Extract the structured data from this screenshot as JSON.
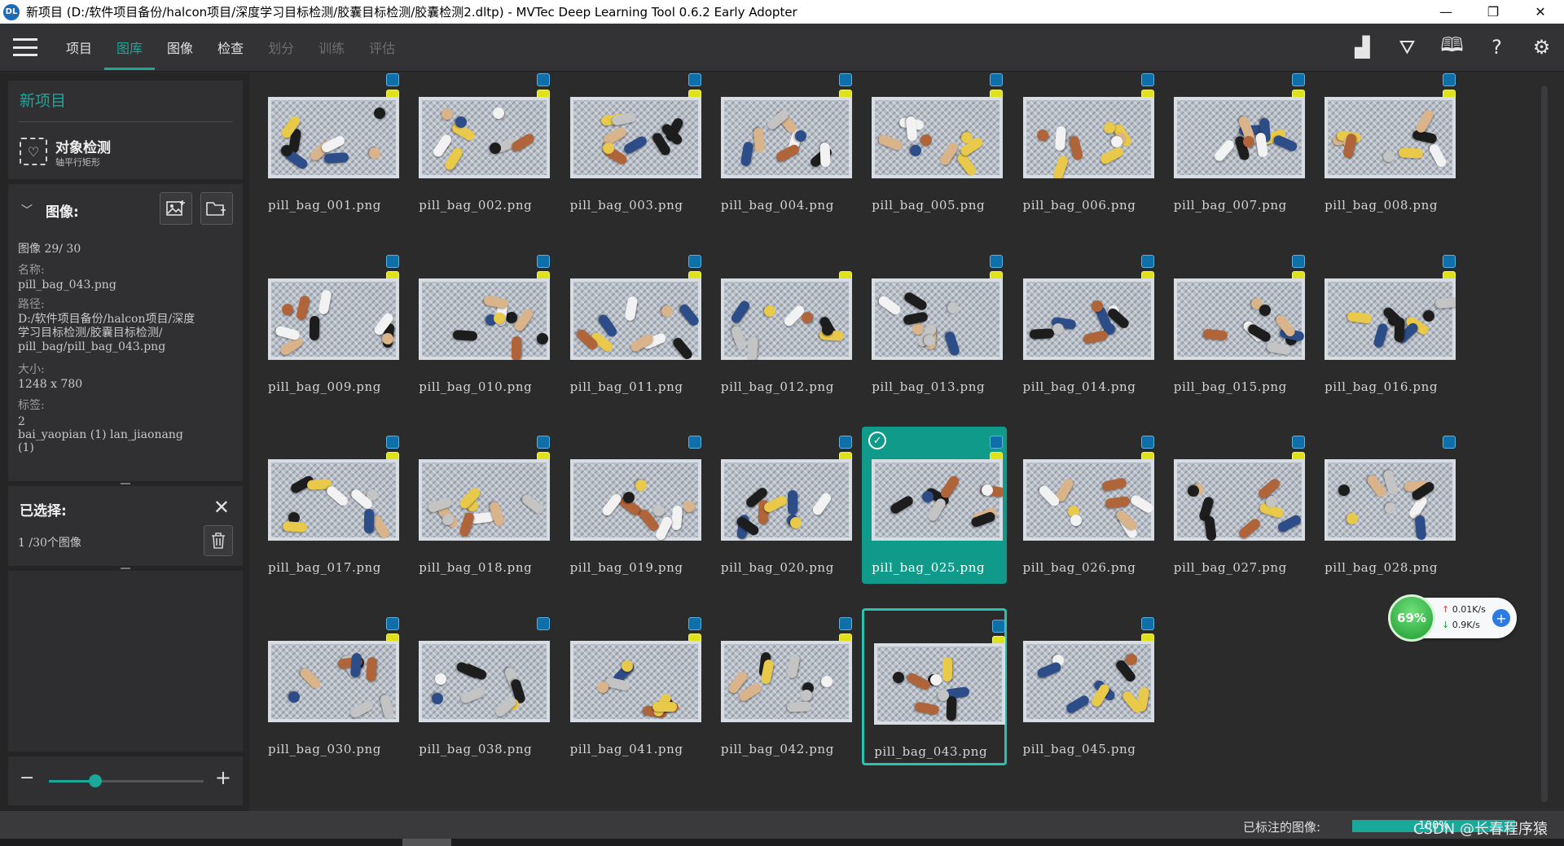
{
  "window": {
    "title": "新项目 (D:/软件项目备份/halcon项目/深度学习目标检测/胶囊目标检测/胶囊检测2.dltp) - MVTec Deep Learning Tool 0.6.2 Early Adopter",
    "app_icon_text": "DL",
    "controls": {
      "minimize": "—",
      "maximize": "❐",
      "close": "✕"
    }
  },
  "menubar": {
    "tabs": [
      {
        "label": "项目",
        "state": "normal"
      },
      {
        "label": "图库",
        "state": "active"
      },
      {
        "label": "图像",
        "state": "normal"
      },
      {
        "label": "检查",
        "state": "normal"
      },
      {
        "label": "划分",
        "state": "disabled"
      },
      {
        "label": "训练",
        "state": "disabled"
      },
      {
        "label": "评估",
        "state": "disabled"
      }
    ],
    "tools": [
      {
        "name": "statistics-icon",
        "glyph": "▟"
      },
      {
        "name": "filter-icon",
        "glyph": "⛛"
      },
      {
        "name": "book-icon",
        "glyph": "🕮"
      },
      {
        "name": "help-icon",
        "glyph": "?"
      },
      {
        "name": "gear-icon",
        "glyph": "⚙"
      }
    ]
  },
  "project": {
    "title": "新项目",
    "type_title": "对象检测",
    "type_subtitle": "轴平行矩形"
  },
  "image_panel": {
    "header": "图像:",
    "index_text": "图像 29/ 30",
    "name_label": "名称:",
    "name_value": "pill_bag_043.png",
    "path_label": "路径:",
    "path_value_1": "D:/软件项目备份/halcon项目/深度",
    "path_value_2": "学习目标检测/胶囊目标检测/",
    "path_value_3": "pill_bag/pill_bag_043.png",
    "size_label": "大小:",
    "size_value": "1248 x 780",
    "tags_label": "标签:",
    "tags_count": "2",
    "tags_value_1": "bai_yaopian (1) lan_jiaonang",
    "tags_value_2": "(1)"
  },
  "selected_panel": {
    "header": "已选择:",
    "count_text": "1 /30个图像"
  },
  "zoom": {
    "minus": "−",
    "plus": "+",
    "level": 0.3
  },
  "colors": {
    "accent": "#19a89a",
    "badge_blue": "#0f6fa8",
    "badge_yellow": "#dfe21a"
  },
  "thumbnails": [
    {
      "label": "pill_bag_001.png",
      "badges": [
        "blue",
        "yellow"
      ]
    },
    {
      "label": "pill_bag_002.png",
      "badges": [
        "blue",
        "yellow"
      ]
    },
    {
      "label": "pill_bag_003.png",
      "badges": [
        "blue",
        "yellow"
      ]
    },
    {
      "label": "pill_bag_004.png",
      "badges": [
        "blue",
        "yellow"
      ]
    },
    {
      "label": "pill_bag_005.png",
      "badges": [
        "blue",
        "yellow"
      ]
    },
    {
      "label": "pill_bag_006.png",
      "badges": [
        "blue",
        "yellow"
      ]
    },
    {
      "label": "pill_bag_007.png",
      "badges": [
        "blue",
        "yellow"
      ]
    },
    {
      "label": "pill_bag_008.png",
      "badges": [
        "blue",
        "yellow"
      ]
    },
    {
      "label": "pill_bag_009.png",
      "badges": [
        "blue",
        "yellow"
      ]
    },
    {
      "label": "pill_bag_010.png",
      "badges": [
        "blue",
        "yellow"
      ]
    },
    {
      "label": "pill_bag_011.png",
      "badges": [
        "blue",
        "yellow"
      ]
    },
    {
      "label": "pill_bag_012.png",
      "badges": [
        "yellow"
      ]
    },
    {
      "label": "pill_bag_013.png",
      "badges": [
        "blue",
        "yellow"
      ]
    },
    {
      "label": "pill_bag_014.png",
      "badges": [
        "blue",
        "yellow"
      ]
    },
    {
      "label": "pill_bag_015.png",
      "badges": [
        "blue",
        "yellow"
      ]
    },
    {
      "label": "pill_bag_016.png",
      "badges": [
        "blue",
        "yellow"
      ]
    },
    {
      "label": "pill_bag_017.png",
      "badges": [
        "blue",
        "yellow"
      ]
    },
    {
      "label": "pill_bag_018.png",
      "badges": [
        "blue",
        "yellow"
      ]
    },
    {
      "label": "pill_bag_019.png",
      "badges": [
        "blue"
      ]
    },
    {
      "label": "pill_bag_020.png",
      "badges": [
        "blue",
        "yellow"
      ]
    },
    {
      "label": "pill_bag_025.png",
      "badges": [
        "blue",
        "yellow"
      ],
      "selected": true
    },
    {
      "label": "pill_bag_026.png",
      "badges": [
        "blue",
        "yellow"
      ]
    },
    {
      "label": "pill_bag_027.png",
      "badges": [
        "blue",
        "yellow"
      ]
    },
    {
      "label": "pill_bag_028.png",
      "badges": [
        "blue"
      ]
    },
    {
      "label": "pill_bag_030.png",
      "badges": [
        "blue",
        "yellow"
      ]
    },
    {
      "label": "pill_bag_038.png",
      "badges": [
        "blue"
      ]
    },
    {
      "label": "pill_bag_041.png",
      "badges": [
        "blue",
        "yellow"
      ]
    },
    {
      "label": "pill_bag_042.png",
      "badges": [
        "blue",
        "yellow"
      ]
    },
    {
      "label": "pill_bag_043.png",
      "badges": [
        "blue",
        "yellow"
      ],
      "current": true
    },
    {
      "label": "pill_bag_045.png",
      "badges": [
        "blue",
        "yellow"
      ]
    }
  ],
  "net_widget": {
    "percent": "69%",
    "up": "0.01K/s",
    "down": "0.9K/s",
    "up_arrow": "↑",
    "down_arrow": "↓"
  },
  "statusbar": {
    "label": "已标注的图像:",
    "progress_text": "100%",
    "progress": 1.0,
    "watermark": "CSDN @长春程序猿"
  }
}
